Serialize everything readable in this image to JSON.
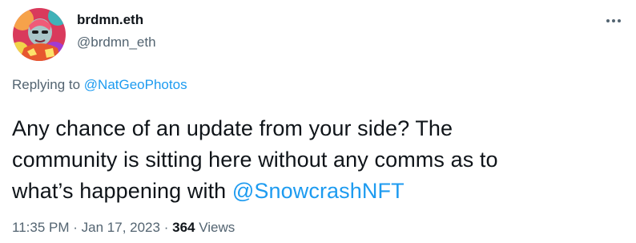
{
  "author": {
    "display_name": "brdmn.eth",
    "handle": "@brdmn_eth",
    "avatar": "avatar-image"
  },
  "more_icon": "more-horizontal-icon",
  "reply_context": {
    "prefix": "Replying to",
    "mention": "@NatGeoPhotos"
  },
  "tweet": {
    "text_line_1": "Any chance of an update from your side? The",
    "text_line_2": "community is sitting here without any comms as to",
    "text_line_3_prefix": "what’s happening with",
    "mention": "@SnowcrashNFT"
  },
  "meta": {
    "time": "11:35 PM",
    "separator_1": "·",
    "date": "Jan 17, 2023",
    "separator_2": "·",
    "views_count": "364",
    "views_label": "Views"
  },
  "colors": {
    "text_primary": "#0f1419",
    "text_secondary": "#536471",
    "link": "#1d9bf0"
  }
}
